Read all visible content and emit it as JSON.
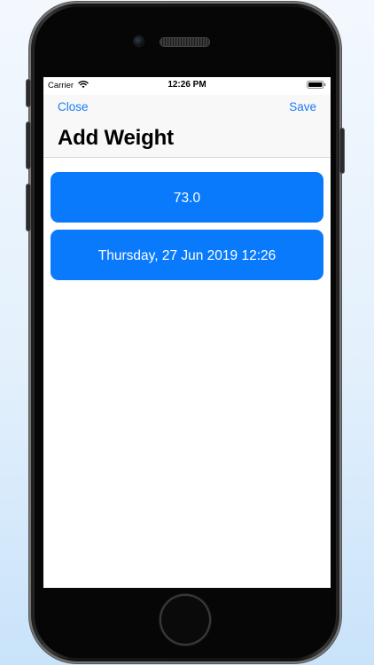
{
  "status_bar": {
    "carrier": "Carrier",
    "time": "12:26 PM",
    "wifi_icon": "wifi-icon",
    "battery_icon": "battery-full-icon"
  },
  "nav": {
    "close_label": "Close",
    "save_label": "Save",
    "title": "Add Weight"
  },
  "form": {
    "weight_value": "73.0",
    "date_value": "Thursday, 27 Jun 2019 12:26"
  },
  "colors": {
    "accent": "#1a7cf5",
    "button_bg": "#0a7afd",
    "nav_bg": "#f8f8f8",
    "screen_bg": "#ffffff"
  }
}
